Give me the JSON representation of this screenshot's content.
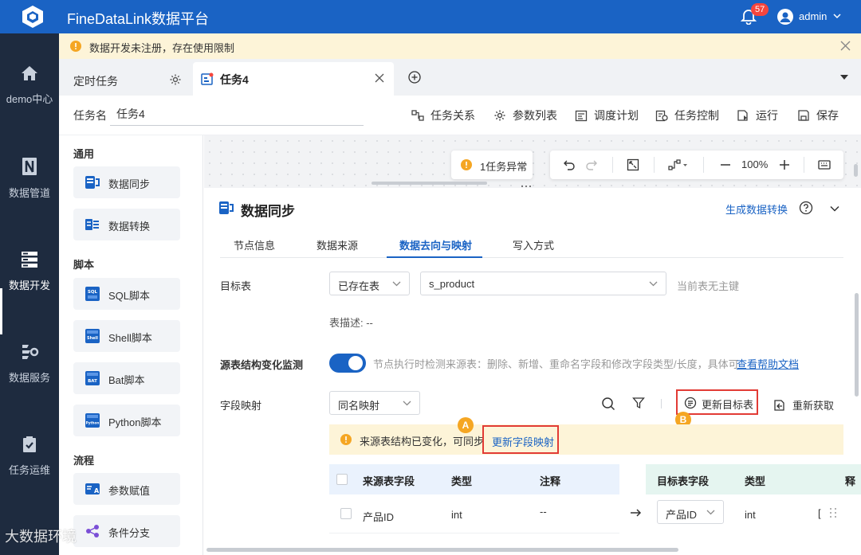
{
  "app": {
    "title": "FineDataLink数据平台",
    "notification_count": "57",
    "user": "admin"
  },
  "sidebar": {
    "items": [
      {
        "label": "demo中心",
        "icon": "home-icon"
      },
      {
        "label": "数据管道",
        "icon": "pipeline-icon"
      },
      {
        "label": "数据开发",
        "icon": "development-icon",
        "active": true
      },
      {
        "label": "数据服务",
        "icon": "service-icon"
      },
      {
        "label": "任务运维",
        "icon": "ops-icon"
      }
    ]
  },
  "notice": {
    "text": "数据开发未注册，存在使用限制"
  },
  "tabs": [
    {
      "label": "定时任务"
    },
    {
      "label": "任务4",
      "active": true
    }
  ],
  "task": {
    "name_label": "任务名",
    "name_value": "任务4"
  },
  "toolbar": {
    "relation": "任务关系",
    "params": "参数列表",
    "schedule": "调度计划",
    "control": "任务控制",
    "run": "运行",
    "save": "保存"
  },
  "palette": {
    "sections": [
      {
        "title": "通用",
        "items": [
          "数据同步",
          "数据转换"
        ]
      },
      {
        "title": "脚本",
        "items": [
          "SQL脚本",
          "Shell脚本",
          "Bat脚本",
          "Python脚本"
        ]
      },
      {
        "title": "流程",
        "items": [
          "参数赋值",
          "条件分支"
        ]
      }
    ]
  },
  "canvas": {
    "error_chip": "1任务异常",
    "zoom": "100%"
  },
  "panel": {
    "title": "数据同步",
    "generate_link": "生成数据转换",
    "subtabs": [
      "节点信息",
      "数据来源",
      "数据去向与映射",
      "写入方式"
    ],
    "active_subtab": "数据去向与映射",
    "target_label": "目标表",
    "target_mode": "已存在表",
    "target_table": "s_product",
    "no_pk": "当前表无主键",
    "table_desc": "表描述: --",
    "monitor_label": "源表结构变化监测",
    "monitor_on": true,
    "monitor_desc": "节点执行时检测来源表：删除、新增、重命名字段和修改字段类型/长度，具体可",
    "help_doc": "查看帮助文档",
    "mapping_label": "字段映射",
    "mapping_mode": "同名映射",
    "update_target": "更新目标表",
    "refetch": "重新获取",
    "marker_a": "A",
    "marker_b": "B",
    "warning": "来源表结构已变化，可同步",
    "update_mapping": "更新字段映射"
  },
  "source_table": {
    "headers": [
      "来源表字段",
      "类型",
      "注释"
    ],
    "rows": [
      {
        "field": "产品ID",
        "type": "int",
        "comment": "--"
      }
    ]
  },
  "target_table": {
    "headers": [
      "目标表字段",
      "类型",
      "释"
    ],
    "rows": [
      {
        "field": "产品ID",
        "type": "int",
        "extra": "["
      }
    ]
  },
  "watermark": "大数据环境",
  "colors": {
    "brand": "#1a63c4",
    "sidebar": "#1e2b3f",
    "warning_bg": "#fdf4d8",
    "highlight": "#e23b35",
    "marker": "#f5a623"
  }
}
